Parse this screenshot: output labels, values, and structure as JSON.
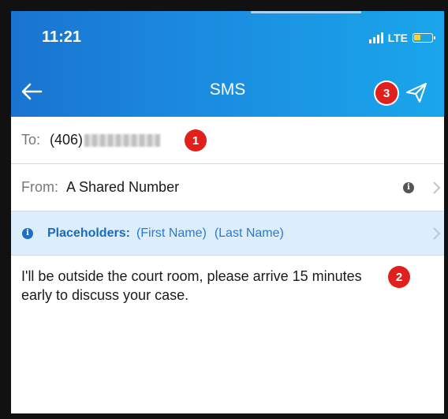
{
  "status_bar": {
    "time": "11:21",
    "network": "LTE"
  },
  "nav": {
    "title": "SMS"
  },
  "to_field": {
    "label": "To:",
    "number_prefix": "(406)"
  },
  "from_field": {
    "label": "From:",
    "value": "A Shared Number"
  },
  "placeholders": {
    "label": "Placeholders:",
    "tokens": [
      "(First Name)",
      "(Last Name)"
    ]
  },
  "message": {
    "text": "I'll be outside the court room, please arrive 15 minutes early to discuss your case."
  },
  "badges": [
    "1",
    "2",
    "3"
  ],
  "colors": {
    "header_start": "#1a74cf",
    "header_end": "#1aa6ea",
    "placeholder_bg": "#dcedfb",
    "placeholder_text": "#1a6bc0",
    "badge": "#e0201c",
    "battery": "#f6d33a"
  },
  "icons": {
    "back": "arrow-left-icon",
    "send": "paper-plane-icon",
    "info": "info-icon",
    "chevron": "chevron-right-icon"
  }
}
